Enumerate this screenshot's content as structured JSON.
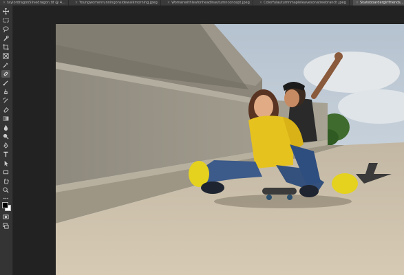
{
  "tabs": [
    {
      "label": "taylordragon5livedragon.tif @ 4...",
      "active": false
    },
    {
      "label": "Youngwomenrunningonsidewalkmorning.jpeg",
      "active": false
    },
    {
      "label": "Womanwithleafonheadinautumnconcept.jpeg",
      "active": false
    },
    {
      "label": "Colorfulautumnmapleleavesonatreebranch.jpeg",
      "active": false
    },
    {
      "label": "Skateboardergirlfriends...",
      "active": true
    }
  ],
  "tools": [
    {
      "name": "move-tool-icon"
    },
    {
      "name": "marquee-tool-icon"
    },
    {
      "name": "lasso-tool-icon"
    },
    {
      "name": "quick-selection-tool-icon"
    },
    {
      "name": "crop-tool-icon"
    },
    {
      "name": "frame-tool-icon"
    },
    {
      "name": "eyedropper-tool-icon"
    },
    {
      "name": "healing-brush-tool-icon",
      "selected": true
    },
    {
      "name": "brush-tool-icon"
    },
    {
      "name": "clone-stamp-tool-icon"
    },
    {
      "name": "history-brush-tool-icon"
    },
    {
      "name": "eraser-tool-icon"
    },
    {
      "name": "gradient-tool-icon"
    },
    {
      "name": "blur-tool-icon"
    },
    {
      "name": "dodge-tool-icon"
    },
    {
      "name": "pen-tool-icon"
    },
    {
      "name": "type-tool-icon"
    },
    {
      "name": "path-selection-tool-icon"
    },
    {
      "name": "shape-tool-icon"
    },
    {
      "name": "hand-tool-icon"
    },
    {
      "name": "zoom-tool-icon"
    },
    {
      "name": "more-tools-icon"
    }
  ],
  "colors": {
    "foreground": "#000000",
    "background": "#ffffff",
    "toolbar_bg": "#343434",
    "tabbar_bg": "#3a3a3a",
    "active_tab": "#515151"
  }
}
